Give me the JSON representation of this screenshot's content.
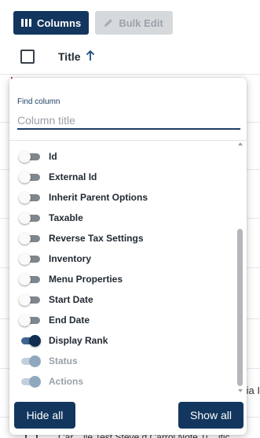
{
  "toolbar": {
    "columns_label": "Columns",
    "bulk_edit_label": "Bulk Edit"
  },
  "table": {
    "header_title": "Title",
    "peek_fragment": "ia I",
    "bottom_row_text": "Car... ile Test Steve d Carrol Note Ti... ific"
  },
  "find": {
    "label": "Find column",
    "placeholder": "Column title",
    "value": ""
  },
  "columns": [
    {
      "label": "Id",
      "state": "off"
    },
    {
      "label": "External Id",
      "state": "off"
    },
    {
      "label": "Inherit Parent Options",
      "state": "off"
    },
    {
      "label": "Taxable",
      "state": "off"
    },
    {
      "label": "Reverse Tax Settings",
      "state": "off"
    },
    {
      "label": "Inventory",
      "state": "off"
    },
    {
      "label": "Menu Properties",
      "state": "off"
    },
    {
      "label": "Start Date",
      "state": "off"
    },
    {
      "label": "End Date",
      "state": "off"
    },
    {
      "label": "Display Rank",
      "state": "on"
    },
    {
      "label": "Status",
      "state": "disabled"
    },
    {
      "label": "Actions",
      "state": "disabled"
    }
  ],
  "actions": {
    "hide_all_label": "Hide all",
    "show_all_label": "Show all"
  },
  "colors": {
    "primary": "#13365e",
    "accent_red": "#c9252b",
    "disabled_text": "#9aa0a8"
  },
  "icons": {
    "columns": "columns-icon",
    "bulk_edit": "pencil-icon",
    "sort": "arrow-up-icon"
  }
}
